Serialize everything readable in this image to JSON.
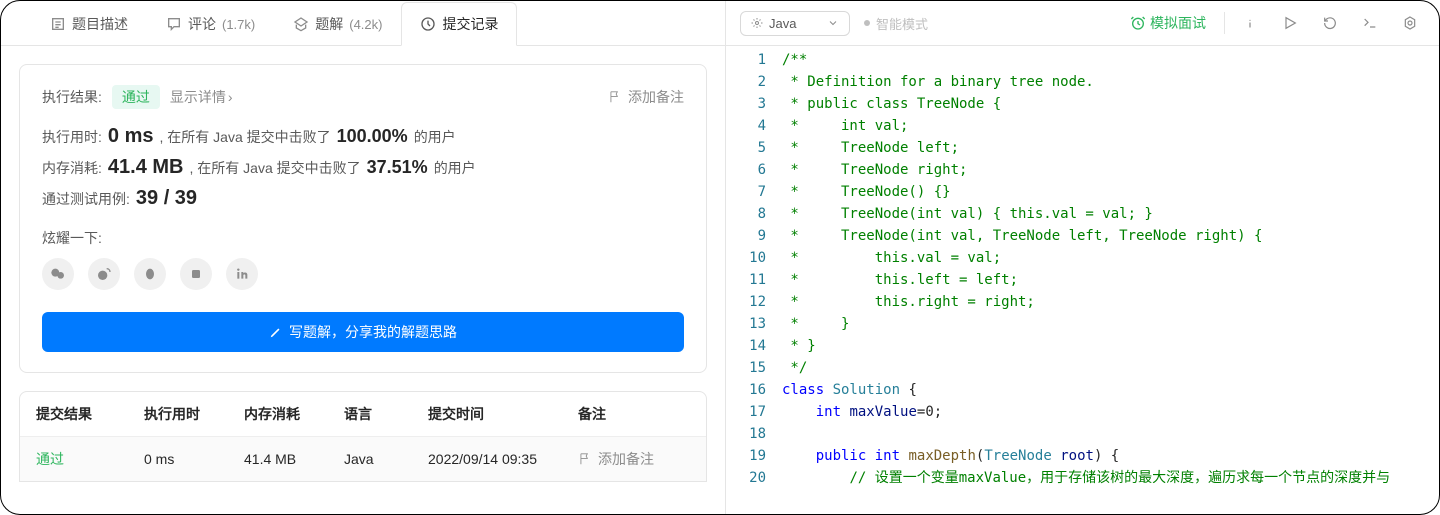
{
  "tabs": {
    "desc": "题目描述",
    "comment": "评论",
    "comment_count": "(1.7k)",
    "solution": "题解",
    "solution_count": "(4.2k)",
    "submission": "提交记录"
  },
  "result": {
    "label": "执行结果:",
    "status": "通过",
    "show_detail": "显示详情",
    "add_note": "添加备注"
  },
  "runtime": {
    "label": "执行用时:",
    "value": "0 ms",
    "beats_prefix": ", 在所有 Java 提交中击败了",
    "percent": "100.00%",
    "suffix": "的用户"
  },
  "memory": {
    "label": "内存消耗:",
    "value": "41.4 MB",
    "beats_prefix": ", 在所有 Java 提交中击败了",
    "percent": "37.51%",
    "suffix": "的用户"
  },
  "testcase": {
    "label": "通过测试用例:",
    "value": "39 / 39"
  },
  "brag_label": "炫耀一下:",
  "write_solution": "写题解，分享我的解题思路",
  "table": {
    "h_result": "提交结果",
    "h_time": "执行用时",
    "h_mem": "内存消耗",
    "h_lang": "语言",
    "h_date": "提交时间",
    "h_note": "备注",
    "row": {
      "result": "通过",
      "time": "0 ms",
      "mem": "41.4 MB",
      "lang": "Java",
      "date": "2022/09/14 09:35",
      "note": "添加备注"
    }
  },
  "toolbar": {
    "language": "Java",
    "smart_mode": "智能模式",
    "mock": "模拟面试"
  },
  "code_lines": [
    [
      {
        "t": "/**",
        "c": "c-green"
      }
    ],
    [
      {
        "t": " * Definition for a binary tree node.",
        "c": "c-green"
      }
    ],
    [
      {
        "t": " * public class TreeNode {",
        "c": "c-green"
      }
    ],
    [
      {
        "t": " *     int val;",
        "c": "c-green"
      }
    ],
    [
      {
        "t": " *     TreeNode left;",
        "c": "c-green"
      }
    ],
    [
      {
        "t": " *     TreeNode right;",
        "c": "c-green"
      }
    ],
    [
      {
        "t": " *     TreeNode() {}",
        "c": "c-green"
      }
    ],
    [
      {
        "t": " *     TreeNode(int val) { this.val = val; }",
        "c": "c-green"
      }
    ],
    [
      {
        "t": " *     TreeNode(int val, TreeNode left, TreeNode right) {",
        "c": "c-green"
      }
    ],
    [
      {
        "t": " *         this.val = val;",
        "c": "c-green"
      }
    ],
    [
      {
        "t": " *         this.left = left;",
        "c": "c-green"
      }
    ],
    [
      {
        "t": " *         this.right = right;",
        "c": "c-green"
      }
    ],
    [
      {
        "t": " *     }",
        "c": "c-green"
      }
    ],
    [
      {
        "t": " * }",
        "c": "c-green"
      }
    ],
    [
      {
        "t": " */",
        "c": "c-green"
      }
    ],
    [
      {
        "t": "class ",
        "c": "c-blue"
      },
      {
        "t": "Solution",
        "c": "c-teal"
      },
      {
        "t": " {",
        "c": ""
      }
    ],
    [
      {
        "t": "    ",
        "c": ""
      },
      {
        "t": "int",
        "c": "c-blue"
      },
      {
        "t": " ",
        "c": ""
      },
      {
        "t": "maxValue",
        "c": "c-vblue"
      },
      {
        "t": "=0;",
        "c": ""
      }
    ],
    [
      {
        "t": "",
        "c": ""
      }
    ],
    [
      {
        "t": "    ",
        "c": ""
      },
      {
        "t": "public",
        "c": "c-blue"
      },
      {
        "t": " ",
        "c": ""
      },
      {
        "t": "int",
        "c": "c-blue"
      },
      {
        "t": " ",
        "c": ""
      },
      {
        "t": "maxDepth",
        "c": "c-brown"
      },
      {
        "t": "(",
        "c": ""
      },
      {
        "t": "TreeNode",
        "c": "c-teal"
      },
      {
        "t": " ",
        "c": ""
      },
      {
        "t": "root",
        "c": "c-vblue"
      },
      {
        "t": ") {",
        "c": ""
      }
    ],
    [
      {
        "t": "        ",
        "c": ""
      },
      {
        "t": "// 设置一个变量maxValue，用于存储该树的最大深度，遍历求每一个节点的深度并与",
        "c": "c-green"
      }
    ]
  ]
}
